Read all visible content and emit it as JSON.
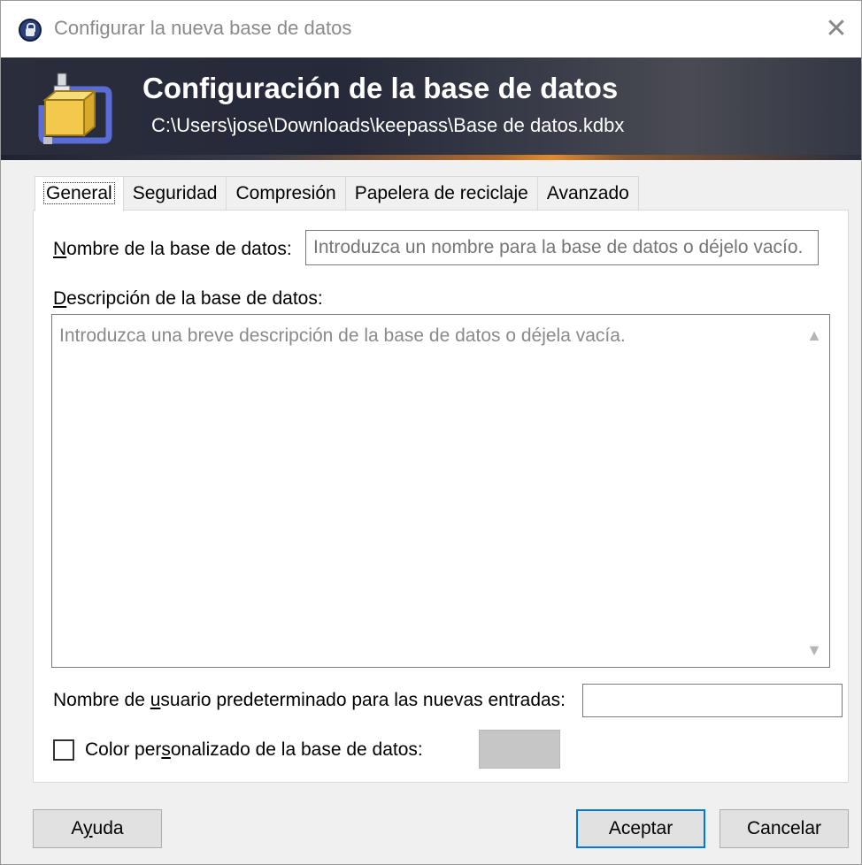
{
  "window": {
    "title": "Configurar la nueva base de datos",
    "close_icon": "close-icon"
  },
  "banner": {
    "title": "Configuración de la base de datos",
    "subtitle": "C:\\Users\\jose\\Downloads\\keepass\\Base de datos.kdbx"
  },
  "tabs": [
    {
      "label": "General",
      "active": true
    },
    {
      "label": "Seguridad",
      "active": false
    },
    {
      "label": "Compresión",
      "active": false
    },
    {
      "label": "Papelera de reciclaje",
      "active": false
    },
    {
      "label": "Avanzado",
      "active": false
    }
  ],
  "general": {
    "db_name_label_first": "N",
    "db_name_label_rest": "ombre de la base de datos:",
    "db_name_placeholder": "Introduzca un nombre para la base de datos o déjelo vacío.",
    "db_name_value": "",
    "description_label_first": "D",
    "description_label_rest": "escripción de la base de datos:",
    "description_placeholder": "Introduzca una breve descripción de la base de datos o déjela vacía.",
    "description_value": "",
    "username_label_pre": "Nombre de ",
    "username_label_u": "u",
    "username_label_post": "suario predeterminado para las nuevas entradas:",
    "username_value": "",
    "color_checkbox_checked": false,
    "color_label_pre": "Color per",
    "color_label_u": "s",
    "color_label_post": "onalizado de la base de datos:",
    "color_swatch": "#c6c6c6"
  },
  "buttons": {
    "help_pre": "A",
    "help_u": "y",
    "help_post": "uda",
    "ok": "Aceptar",
    "cancel": "Cancelar"
  },
  "colors": {
    "accent": "#0078d7",
    "banner_bg": "#2a2d3c",
    "banner_accent": "#e58a2d"
  }
}
